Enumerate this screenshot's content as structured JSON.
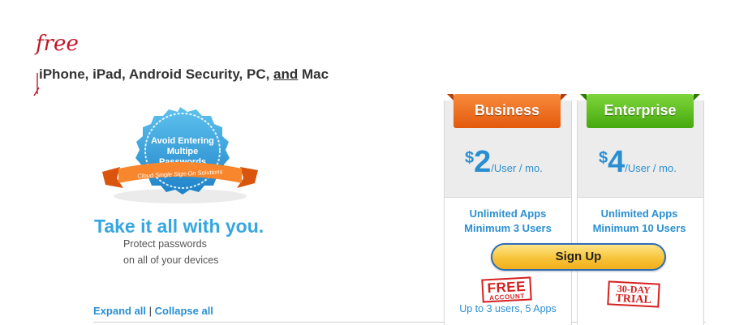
{
  "annotation": {
    "text": "free"
  },
  "headline": {
    "part1": "iPhone, iPad, Android Security, PC, ",
    "and": "and",
    "part2": " Mac"
  },
  "badge": {
    "line1": "Avoid Entering",
    "line2": "Multipe",
    "line3": "Passwords",
    "ribbon_text": "Cloud Single Sign-On Solutions"
  },
  "hero": {
    "tagline": "Take it all with you.",
    "sub1": "Protect passwords",
    "sub2": "on all of your devices"
  },
  "links": {
    "expand": "Expand all",
    "separator": "|",
    "collapse": "Collapse all"
  },
  "plans": {
    "business": {
      "name": "Business",
      "dollar": "$",
      "amount": "2",
      "per": "/User / mo.",
      "feature1": "Unlimited Apps",
      "feature2": "Minimum 3 Users",
      "stamp_line1": "FREE",
      "stamp_line2": "ACCOUNT",
      "footnote": "Up to 3 users, 5 Apps"
    },
    "enterprise": {
      "name": "Enterprise",
      "dollar": "$",
      "amount": "4",
      "per": "/User / mo.",
      "feature1": "Unlimited Apps",
      "feature2": "Minimum 10 Users",
      "stamp_line1": "30-DAY",
      "stamp_line2": "TRIAL"
    }
  },
  "signup_label": "Sign Up",
  "colors": {
    "accent_blue": "#2a8fd2",
    "tagline_blue": "#35a6e0",
    "business_orange": "#e35a0c",
    "enterprise_green": "#45a90e",
    "stamp_red": "#d62020",
    "signup_yellow": "#f7c43a"
  }
}
